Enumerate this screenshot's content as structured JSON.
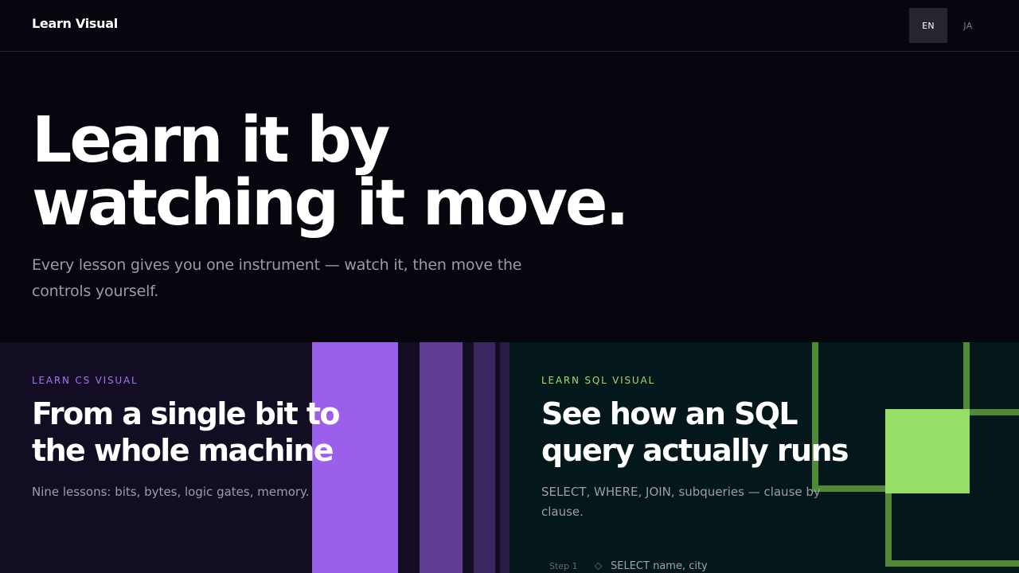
{
  "header": {
    "brand": "Learn Visual",
    "languages": [
      {
        "code": "EN",
        "active": true
      },
      {
        "code": "JA",
        "active": false
      }
    ]
  },
  "hero": {
    "title_lines": [
      "Learn it by",
      "watching it move."
    ],
    "subtitle": "Every lesson gives you one instrument — watch it, then move the controls yourself."
  },
  "cards": [
    {
      "eyebrow": "LEARN CS VISUAL",
      "title_lines": [
        "From a single bit to",
        "the whole machine"
      ],
      "description": "Nine lessons: bits, bytes, logic gates, memory.",
      "accent": "#9b5fe9"
    },
    {
      "eyebrow": "LEARN SQL VISUAL",
      "title_lines": [
        "See how an SQL",
        "query actually runs"
      ],
      "description": "SELECT, WHERE, JOIN, subqueries — clause by clause.",
      "accent": "#97df67",
      "step": {
        "label": "Step 1",
        "code": "SELECT name, city"
      }
    }
  ],
  "colors": {
    "background": "#07060f",
    "cs_card_bg": "#130d23",
    "sql_card_bg": "#04171a",
    "cs_accent": "#9b5fe9",
    "sql_accent": "#97df67"
  }
}
